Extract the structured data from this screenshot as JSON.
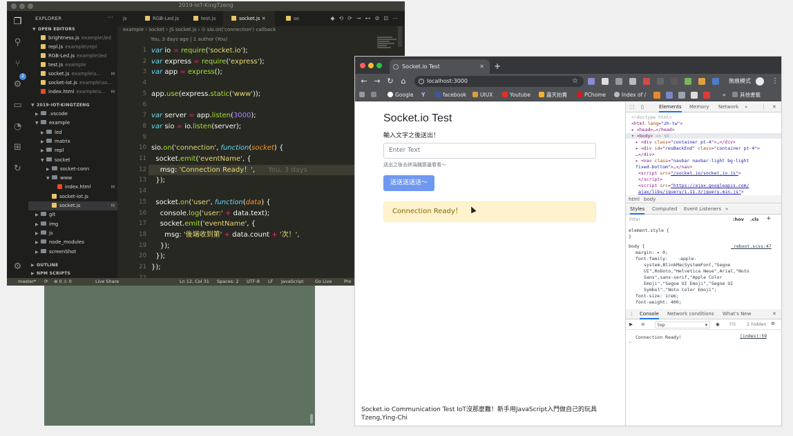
{
  "vscode": {
    "window_title": "2019-IoT-KingTzeng",
    "explorer": {
      "title": "EXPLORER",
      "open_editors_header": "OPEN EDITORS",
      "open_editors": [
        {
          "name": "brightness.js",
          "path": "example\\led",
          "badge": ""
        },
        {
          "name": "repl.js",
          "path": "example\\repl",
          "badge": ""
        },
        {
          "name": "RGB-Led.js",
          "path": "example\\led",
          "badge": ""
        },
        {
          "name": "test.js",
          "path": "example",
          "badge": ""
        },
        {
          "name": "socket.js",
          "path": "example\\s...",
          "badge": "M"
        },
        {
          "name": "socket-iot.js",
          "path": "example\\so...",
          "badge": ""
        },
        {
          "name": "index.html",
          "path": "example\\s...",
          "badge": "M"
        }
      ],
      "project_header": "2019-IOT-KINGTZENG",
      "tree": [
        {
          "name": ".vscode",
          "type": "folder",
          "indent": 1,
          "open": false,
          "badge": ""
        },
        {
          "name": "example",
          "type": "folder",
          "indent": 1,
          "open": true,
          "badge": ""
        },
        {
          "name": "led",
          "type": "folder",
          "indent": 2,
          "open": false,
          "badge": ""
        },
        {
          "name": "matrix",
          "type": "folder",
          "indent": 2,
          "open": false,
          "badge": ""
        },
        {
          "name": "repl",
          "type": "folder",
          "indent": 2,
          "open": false,
          "badge": ""
        },
        {
          "name": "socket",
          "type": "folder",
          "indent": 2,
          "open": true,
          "badge": ""
        },
        {
          "name": "socket-conn",
          "type": "folder",
          "indent": 3,
          "open": false,
          "badge": ""
        },
        {
          "name": "www",
          "type": "folder",
          "indent": 3,
          "open": true,
          "badge": ""
        },
        {
          "name": "index.html",
          "type": "html",
          "indent": 4,
          "open": false,
          "badge": "M"
        },
        {
          "name": "socket-iot.js",
          "type": "js",
          "indent": 3,
          "open": false,
          "badge": ""
        },
        {
          "name": "socket.js",
          "type": "js",
          "indent": 3,
          "open": false,
          "badge": "M"
        },
        {
          "name": "git",
          "type": "folder",
          "indent": 1,
          "open": false,
          "badge": ""
        },
        {
          "name": "img",
          "type": "folder",
          "indent": 1,
          "open": false,
          "badge": ""
        },
        {
          "name": "js",
          "type": "folder",
          "indent": 1,
          "open": false,
          "badge": ""
        },
        {
          "name": "node_modules",
          "type": "folder",
          "indent": 1,
          "open": false,
          "badge": ""
        },
        {
          "name": "screenShot",
          "type": "folder",
          "indent": 1,
          "open": false,
          "badge": ""
        }
      ],
      "outline_header": "OUTLINE",
      "npm_header": "NPM SCRIPTS"
    },
    "tabs": [
      "js",
      "RGB-Led.js",
      "test.js",
      "socket.js",
      "so"
    ],
    "breadcrumb": "example › socket › JS socket.js › ⊙ sio.on('connection') callback",
    "codelens": "You, 3 days ago | 1 author (You)",
    "line_numbers": [
      "1",
      "2",
      "3",
      "4",
      "5",
      "6",
      "7",
      "8",
      "9",
      "10",
      "11",
      "12",
      "13",
      "14",
      "15",
      "16",
      "17",
      "18",
      "19",
      "20",
      "21",
      "22"
    ],
    "ghost_blame": "You, 3 days",
    "status": {
      "branch": "master*",
      "sync": "⟳",
      "problems": "⊗ 0 ⚠ 0",
      "liveshare": "Live Share",
      "position": "Ln 12, Col 31",
      "spaces": "Spaces: 2",
      "encoding": "UTF-8",
      "eol": "LF",
      "language": "JavaScript",
      "golive": "Go Live",
      "prettier": "Pre"
    }
  },
  "chrome": {
    "tab_title": "Socket.io Test",
    "url": "localhost:3000",
    "incognito": "無痕模式",
    "bookmarks": [
      "Google",
      "Y",
      "facebook",
      "UIUX",
      "Youtube",
      "露天拍賣",
      "PChome",
      "Index of /",
      "其他書籤"
    ],
    "page": {
      "title": "Socket.io Test",
      "subtitle": "輸入文字之後送出！",
      "input_placeholder": "Enter Text",
      "help": "送出之後去終端機那邊看看～",
      "button": "送送送送送～",
      "alert": "Connection Ready！",
      "footer_line1": "Socket.io Communication Test IoT沒那麼難！新手用JavaScript入門做自己的玩具",
      "footer_line2": "Tzeng,Ying-Chi"
    },
    "devtools": {
      "tabs": [
        "Elements",
        "Memory",
        "Network",
        "»"
      ],
      "crumbs": [
        "html",
        "body"
      ],
      "style_tabs": [
        "Styles",
        "Computed",
        "Event Listeners",
        "»"
      ],
      "filter_placeholder": "Filter",
      "hov": ":hov",
      "cls": ".cls",
      "element_style": "element.style {",
      "element_style_close": "}",
      "body_rule": "body {",
      "rule_source": "_reboot.scss:47",
      "margin": "margin: ▸ 0;",
      "font_family_label": "font-family:",
      "font_family_1": "-apple-",
      "font_family_2": "system,BlinkMacSystemFont,\"Segoe",
      "font_family_3": "UI\",Roboto,\"Helvetica Neue\",Arial,\"Noto",
      "font_family_4": "Sans\",sans-serif,\"Apple Color",
      "font_family_5": "Emoji\",\"Segoe UI Emoji\",\"Segoe UI",
      "font_family_6": "Symbol\",\"Noto Color Emoji\";",
      "font_size": "font-size: 1rem;",
      "font_weight": "font-weight: 400;",
      "drawer_tabs": [
        "Console",
        "Network conditions",
        "What's New"
      ],
      "context": "top",
      "filter_short": "Filt",
      "hidden": "2 hidden",
      "console_message": "Connection Ready！",
      "console_source": "(index):59"
    }
  }
}
